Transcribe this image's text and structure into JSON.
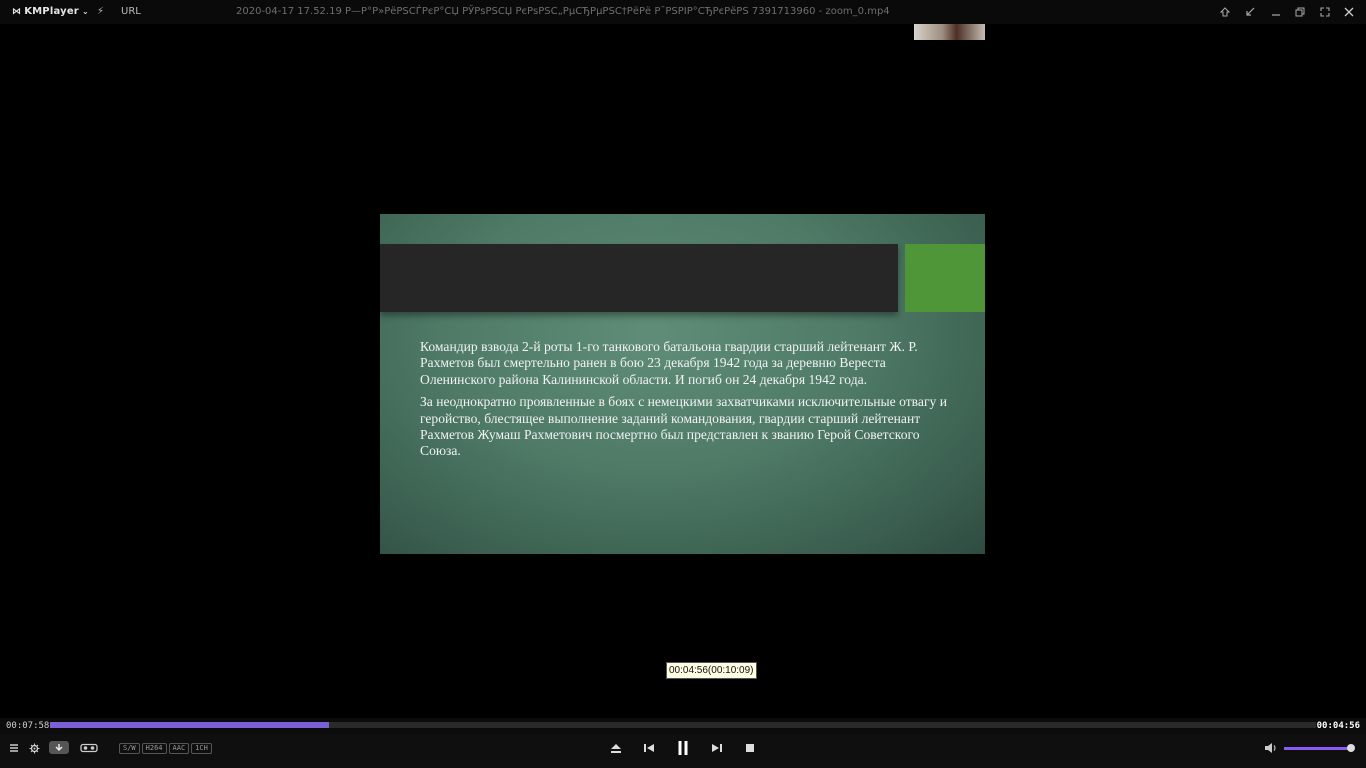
{
  "titlebar": {
    "app_name": "KMPlayer",
    "url_label": "URL",
    "title": "2020-04-17 17.52.19 Р—Р°Р»РёРЅСЃРєР°СЏ РЎРѕРЅСЏ РєРѕРЅС„РµСЂРµРЅС†РёРё Р¯РЅРІР°СЂРєРёРЅ 7391713960 - zoom_0.mp4",
    "buttons": [
      "pin-icon",
      "mini-mode-icon",
      "minimize-icon",
      "restore-icon",
      "fullscreen-icon",
      "close-icon"
    ]
  },
  "slide": {
    "paragraph1": "Командир взвода 2-й роты 1-го танкового батальона гвардии старший лейтенант Ж. Р. Рахметов был смертельно ранен в бою 23 декабря 1942 года за деревню Вереста Оленинского района Калининской области. И погиб он 24 декабря 1942 года.",
    "paragraph2": "За неоднократно проявленные в боях с немецкими захватчиками исключительные отвагу и геройство, блестящее выполнение заданий командования, гвардии старший лейтенант Рахметов Жумаш Рахметович посмертно был представлен к званию Герой Советского Союза."
  },
  "tooltip": "00:04:56(00:10:09)",
  "seek": {
    "elapsed": "00:07:58",
    "hover_time": "00:04:56",
    "progress": 0.22
  },
  "badges": [
    "S/W",
    "H264",
    "AAC",
    "1CH"
  ],
  "volume": 0.98,
  "colors": {
    "accent": "#7b5fd6",
    "slide_green": "#4f9638"
  }
}
